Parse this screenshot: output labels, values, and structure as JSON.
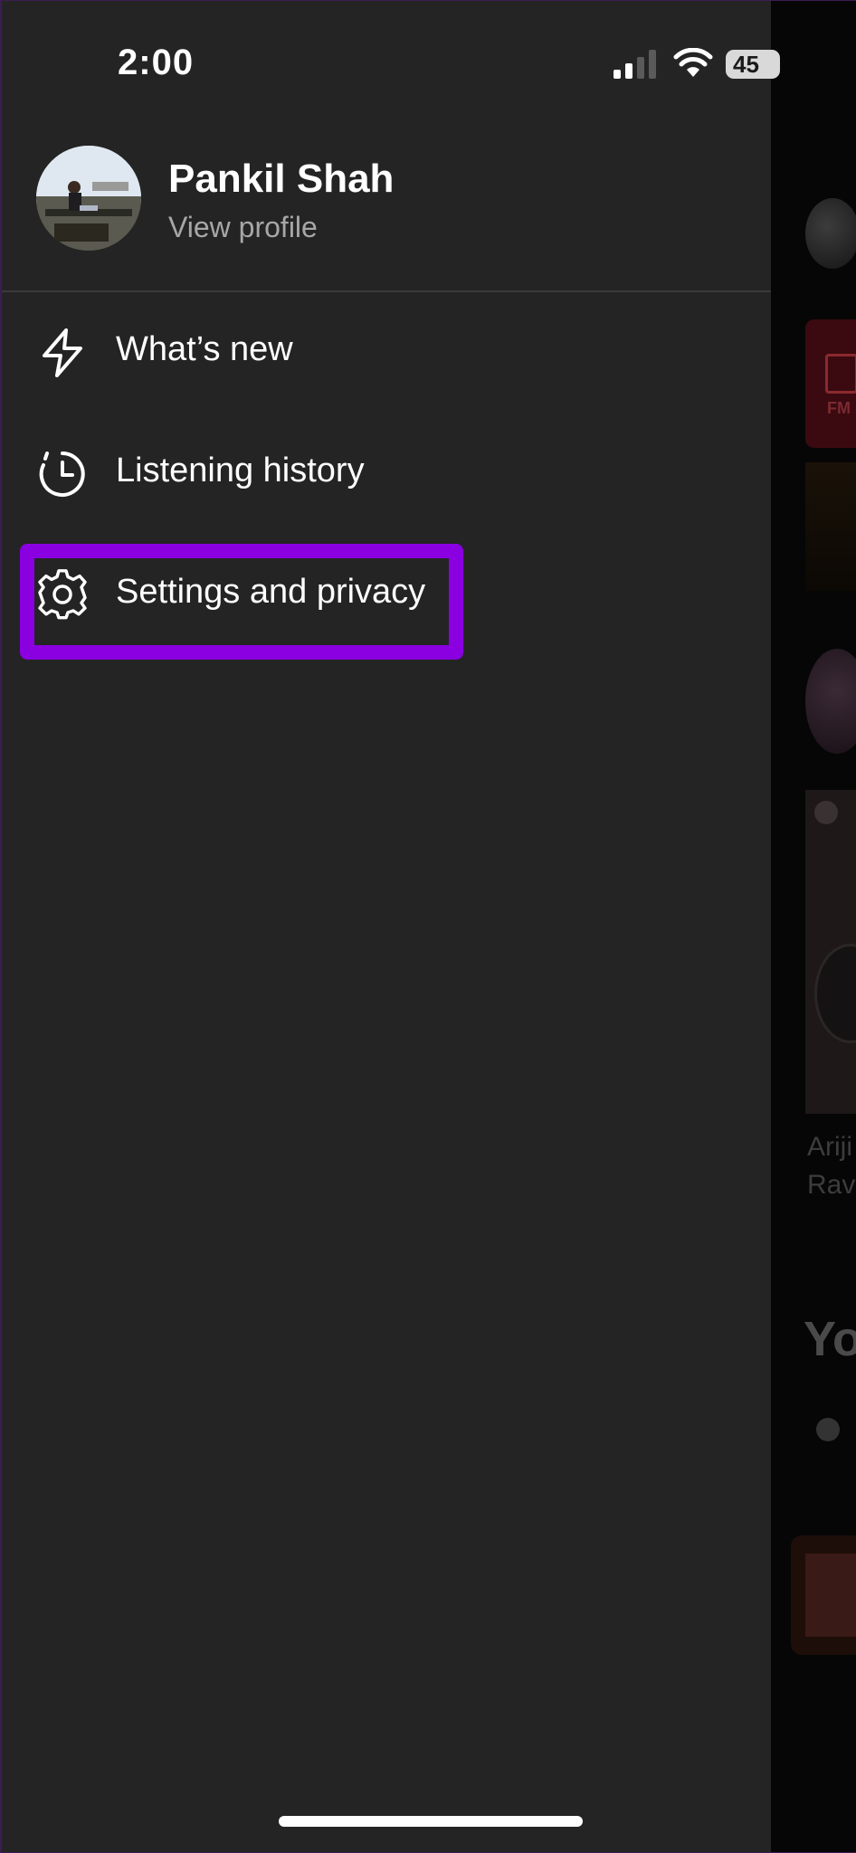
{
  "status": {
    "time": "2:00",
    "battery": "45"
  },
  "profile": {
    "name": "Pankil Shah",
    "subtitle": "View profile"
  },
  "menu": {
    "items": [
      {
        "label": "What’s new",
        "icon": "lightning-icon"
      },
      {
        "label": "Listening history",
        "icon": "clock-history-icon"
      },
      {
        "label": "Settings and privacy",
        "icon": "gear-icon"
      }
    ]
  },
  "annotation": {
    "highlight_color": "#8a00e0",
    "highlighted_item": "Settings and privacy"
  },
  "background": {
    "card_text_1": "Ariji",
    "card_text_2": "Ravi",
    "section_heading": "Yo",
    "fm_text": "FM"
  },
  "colors": {
    "drawer_bg": "#242424",
    "text_primary": "#ffffff",
    "text_secondary": "#a7a7a7",
    "accent_highlight": "#8a00e0"
  }
}
